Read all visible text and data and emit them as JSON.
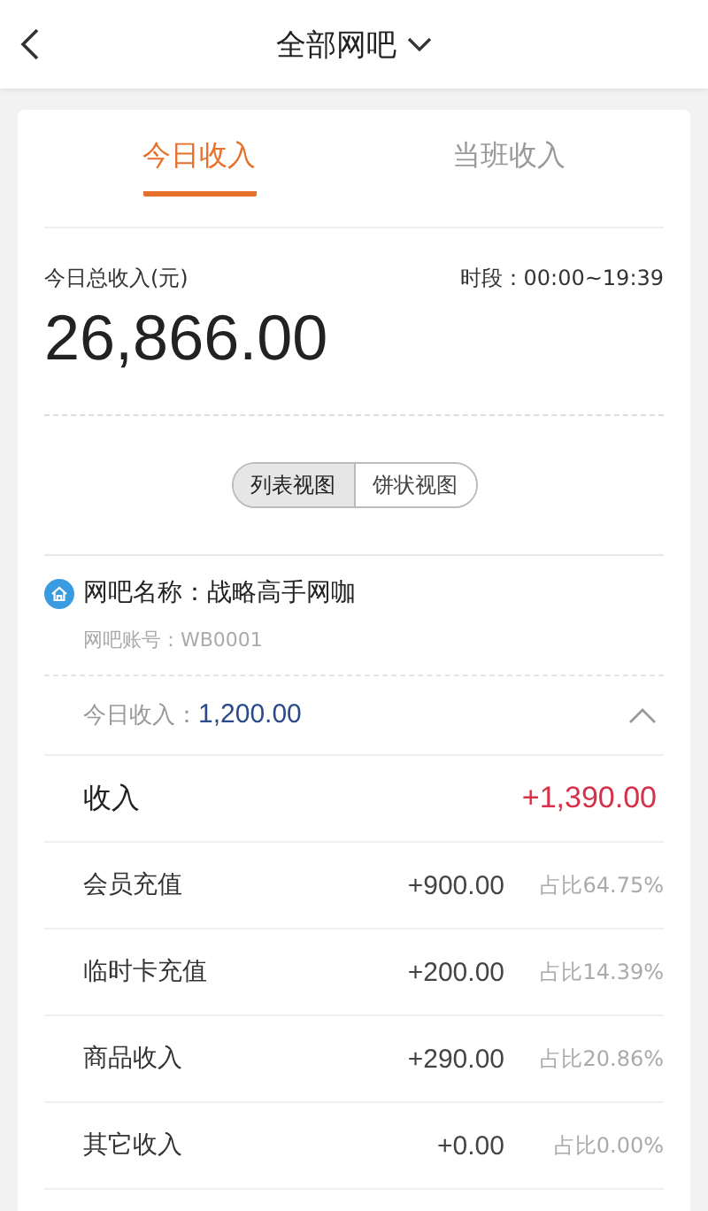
{
  "header": {
    "title": "全部网吧"
  },
  "tabs": [
    {
      "label": "今日收入",
      "selected": true
    },
    {
      "label": "当班收入",
      "selected": false
    }
  ],
  "summary": {
    "label": "今日总收入(元)",
    "period": "时段：00:00~19:39",
    "total": "26,866.00"
  },
  "view_toggle": [
    {
      "label": "列表视图",
      "selected": true
    },
    {
      "label": "饼状视图",
      "selected": false
    }
  ],
  "shop": {
    "name": "网吧名称：战略高手网咖",
    "account": "网吧账号：WB0001",
    "today_label": "今日收入：",
    "today_value": "1,200.00",
    "expanded": true
  },
  "income": {
    "label": "收入",
    "value": "+1,390.00"
  },
  "rows": [
    {
      "name": "会员充值",
      "amount": "+900.00",
      "share": "占比64.75%"
    },
    {
      "name": "临时卡充值",
      "amount": "+200.00",
      "share": "占比14.39%"
    },
    {
      "name": "商品收入",
      "amount": "+290.00",
      "share": "占比20.86%"
    },
    {
      "name": "其它收入",
      "amount": "+0.00",
      "share": "占比0.00%"
    }
  ]
}
